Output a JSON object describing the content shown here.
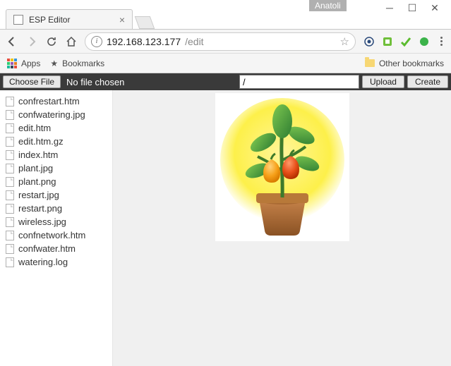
{
  "user_badge": "Anatoli",
  "tab": {
    "title": "ESP Editor"
  },
  "url": {
    "host": "192.168.123.177",
    "path": "/edit"
  },
  "bookbar": {
    "apps": "Apps",
    "bookmarks": "Bookmarks",
    "other": "Other bookmarks"
  },
  "actionbar": {
    "choose": "Choose File",
    "nofile": "No file chosen",
    "path_value": "/",
    "upload": "Upload",
    "create": "Create"
  },
  "files": [
    "confrestart.htm",
    "confwatering.jpg",
    "edit.htm",
    "edit.htm.gz",
    "index.htm",
    "plant.jpg",
    "plant.png",
    "restart.jpg",
    "restart.png",
    "wireless.jpg",
    "confnetwork.htm",
    "confwater.htm",
    "watering.log"
  ]
}
